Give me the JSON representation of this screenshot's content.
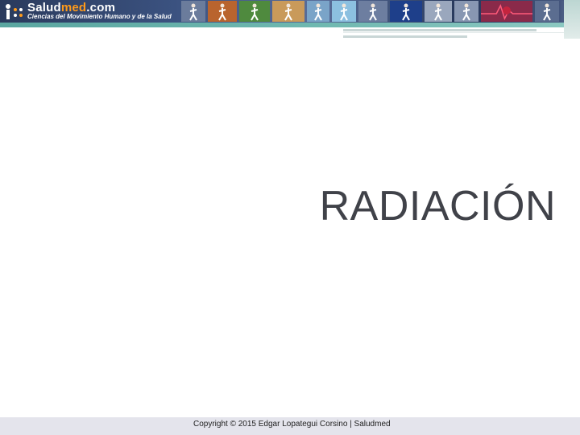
{
  "header": {
    "logo_main": "Salud",
    "logo_accent": "med",
    "logo_tld": ".com",
    "logo_subtitle": "Ciencias del Movimiento Humano y de la Salud",
    "photos": [
      {
        "icon": "runner-photo",
        "color": "#6b7c9c"
      },
      {
        "icon": "runner-photo",
        "color": "#b9642e"
      },
      {
        "icon": "cyclist-photo",
        "color": "#4f8a3e"
      },
      {
        "icon": "walker-photo",
        "color": "#c99a5a"
      },
      {
        "icon": "runner-photo",
        "color": "#7aa4c8"
      },
      {
        "icon": "runner-photo",
        "color": "#8cc0e0"
      },
      {
        "icon": "athlete-photo",
        "color": "#6d7ea0"
      },
      {
        "icon": "stretch-photo",
        "color": "#1e3f8a"
      },
      {
        "icon": "runner-photo",
        "color": "#9aa7bd"
      },
      {
        "icon": "runner-photo",
        "color": "#8897b2"
      },
      {
        "icon": "ecg-heart-photo",
        "color": "#8a2a4a"
      },
      {
        "icon": "runner-photo",
        "color": "#5b6d90"
      },
      {
        "icon": "runner-photo",
        "color": "#4a5c82"
      }
    ]
  },
  "slide": {
    "title": "RADIACIÓN"
  },
  "footer": {
    "copyright": "Copyright © 2015 Edgar Lopategui Corsino | Saludmed"
  },
  "colors": {
    "banner": "#3b5280",
    "logo_accent": "#ff9a1a",
    "teal": "#6fb8b0",
    "title_text": "#404249",
    "footer_bg": "#e4e4ec"
  }
}
